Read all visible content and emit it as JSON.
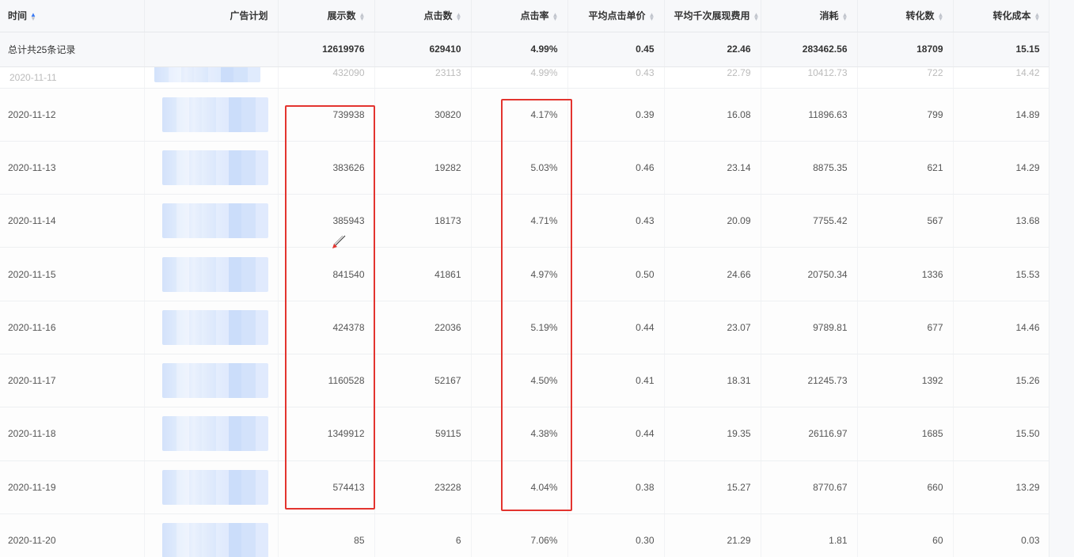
{
  "columns": [
    {
      "label": "时间",
      "active": true
    },
    {
      "label": "广告计划",
      "sortable": false
    },
    {
      "label": "展示数"
    },
    {
      "label": "点击数"
    },
    {
      "label": "点击率"
    },
    {
      "label": "平均点击单价"
    },
    {
      "label": "平均千次展现费用"
    },
    {
      "label": "消耗"
    },
    {
      "label": "转化数"
    },
    {
      "label": "转化成本"
    }
  ],
  "summary": {
    "label": "总计共25条记录",
    "values": [
      "12619976",
      "629410",
      "4.99%",
      "0.45",
      "22.46",
      "283462.56",
      "18709",
      "15.15"
    ]
  },
  "partial_row": {
    "date": "2020-11-11",
    "values": [
      "432090",
      "23113",
      "4.99%",
      "0.43",
      "22.79",
      "10412.73",
      "722",
      "14.42"
    ]
  },
  "rows": [
    {
      "date": "2020-11-12",
      "values": [
        "739938",
        "30820",
        "4.17%",
        "0.39",
        "16.08",
        "11896.63",
        "799",
        "14.89"
      ]
    },
    {
      "date": "2020-11-13",
      "values": [
        "383626",
        "19282",
        "5.03%",
        "0.46",
        "23.14",
        "8875.35",
        "621",
        "14.29"
      ]
    },
    {
      "date": "2020-11-14",
      "values": [
        "385943",
        "18173",
        "4.71%",
        "0.43",
        "20.09",
        "7755.42",
        "567",
        "13.68"
      ]
    },
    {
      "date": "2020-11-15",
      "values": [
        "841540",
        "41861",
        "4.97%",
        "0.50",
        "24.66",
        "20750.34",
        "1336",
        "15.53"
      ]
    },
    {
      "date": "2020-11-16",
      "values": [
        "424378",
        "22036",
        "5.19%",
        "0.44",
        "23.07",
        "9789.81",
        "677",
        "14.46"
      ]
    },
    {
      "date": "2020-11-17",
      "values": [
        "1160528",
        "52167",
        "4.50%",
        "0.41",
        "18.31",
        "21245.73",
        "1392",
        "15.26"
      ]
    },
    {
      "date": "2020-11-18",
      "values": [
        "1349912",
        "59115",
        "4.38%",
        "0.44",
        "19.35",
        "26116.97",
        "1685",
        "15.50"
      ]
    },
    {
      "date": "2020-11-19",
      "values": [
        "574413",
        "23228",
        "4.04%",
        "0.38",
        "15.27",
        "8770.67",
        "660",
        "13.29"
      ]
    },
    {
      "date": "2020-11-20",
      "values": [
        "85",
        "6",
        "7.06%",
        "0.30",
        "21.29",
        "1.81",
        "60",
        "0.03"
      ]
    }
  ],
  "colors": {
    "highlight": "#e3342f",
    "sort_active": "#3a7bf5",
    "header_bg": "#f7f8fa"
  },
  "icons": {
    "sort": "sort-arrows-icon",
    "cursor": "pen-cursor-icon",
    "blurred_cell": "redacted-ad-plan-name"
  }
}
